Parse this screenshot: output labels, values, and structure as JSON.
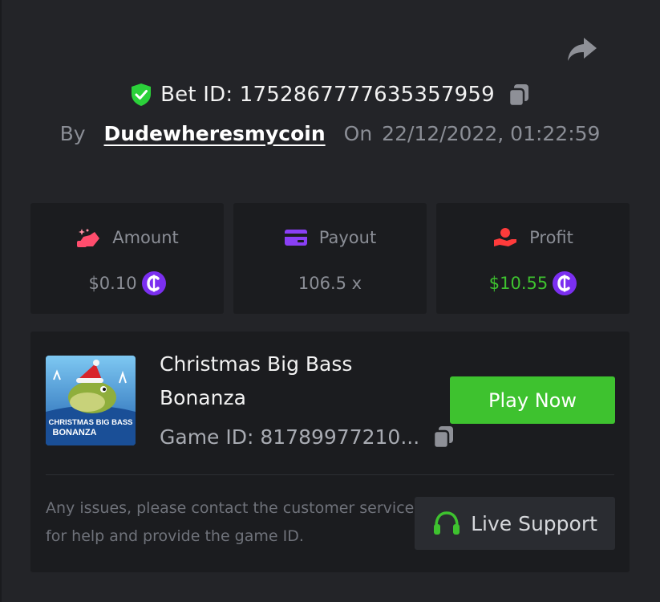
{
  "header": {
    "bet_id": "Bet ID: 1752867777635357959",
    "by_label": "By",
    "username": "Dudewheresmycoin",
    "on_label": "On",
    "datetime": "22/12/2022, 01:22:59"
  },
  "stats": {
    "amount": {
      "label": "Amount",
      "value": "$0.10",
      "icon": "money-bag-icon",
      "icon_color": "#ff4d6d"
    },
    "payout": {
      "label": "Payout",
      "value": "106.5 x",
      "icon": "card-icon",
      "icon_color": "#8a3ff5"
    },
    "profit": {
      "label": "Profit",
      "value": "$10.55",
      "icon": "hand-coin-icon",
      "icon_color": "#ff3b3b",
      "value_color": "#3ec22f"
    }
  },
  "game": {
    "title": "Christmas Big Bass Bonanza",
    "thumb_title_line1": "CHRISTMAS BIG BASS",
    "thumb_title_line2": "BONANZA",
    "game_id": "Game ID: 81789977210...",
    "play_label": "Play Now"
  },
  "support": {
    "help_text": "Any issues, please contact the customer service for help and provide the game ID.",
    "live_support_label": "Live Support"
  },
  "colors": {
    "background": "#232428",
    "card": "#1b1c1f",
    "accent_green": "#3ec22f",
    "coin_purple": "#7b2ff0",
    "shield_green": "#2bd13a"
  }
}
